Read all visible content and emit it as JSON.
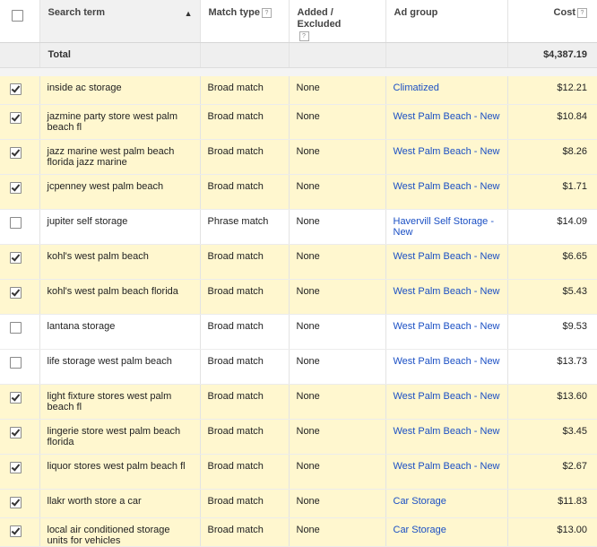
{
  "headers": {
    "search_term": "Search term",
    "match_type": "Match type",
    "added_excluded": "Added / Excluded",
    "ad_group": "Ad group",
    "cost": "Cost",
    "help": "?",
    "sort_arrow": "▲"
  },
  "total": {
    "label": "Total",
    "cost": "$4,387.19"
  },
  "rows": [
    {
      "checked": true,
      "term": "inside ac storage",
      "match": "Broad match",
      "added": "None",
      "ad_group": "Climatized",
      "cost": "$12.21"
    },
    {
      "checked": true,
      "term": "jazmine party store west palm beach fl",
      "match": "Broad match",
      "added": "None",
      "ad_group": "West Palm Beach - New",
      "cost": "$10.84"
    },
    {
      "checked": true,
      "term": "jazz marine west palm beach florida jazz marine",
      "match": "Broad match",
      "added": "None",
      "ad_group": "West Palm Beach - New",
      "cost": "$8.26"
    },
    {
      "checked": true,
      "term": "jcpenney west palm beach",
      "match": "Broad match",
      "added": "None",
      "ad_group": "West Palm Beach - New",
      "cost": "$1.71"
    },
    {
      "checked": false,
      "term": "jupiter self storage",
      "match": "Phrase match",
      "added": "None",
      "ad_group": "Havervill Self Storage - New",
      "cost": "$14.09"
    },
    {
      "checked": true,
      "term": "kohl's west palm beach",
      "match": "Broad match",
      "added": "None",
      "ad_group": "West Palm Beach - New",
      "cost": "$6.65"
    },
    {
      "checked": true,
      "term": "kohl's west palm beach florida",
      "match": "Broad match",
      "added": "None",
      "ad_group": "West Palm Beach - New",
      "cost": "$5.43"
    },
    {
      "checked": false,
      "term": "lantana storage",
      "match": "Broad match",
      "added": "None",
      "ad_group": "West Palm Beach - New",
      "cost": "$9.53"
    },
    {
      "checked": false,
      "term": "life storage west palm beach",
      "match": "Broad match",
      "added": "None",
      "ad_group": "West Palm Beach - New",
      "cost": "$13.73"
    },
    {
      "checked": true,
      "term": "light fixture stores west palm beach fl",
      "match": "Broad match",
      "added": "None",
      "ad_group": "West Palm Beach - New",
      "cost": "$13.60"
    },
    {
      "checked": true,
      "term": "lingerie store west palm beach florida",
      "match": "Broad match",
      "added": "None",
      "ad_group": "West Palm Beach - New",
      "cost": "$3.45"
    },
    {
      "checked": true,
      "term": "liquor stores west palm beach fl",
      "match": "Broad match",
      "added": "None",
      "ad_group": "West Palm Beach - New",
      "cost": "$2.67"
    },
    {
      "checked": true,
      "term": "llakr worth store a car",
      "match": "Broad match",
      "added": "None",
      "ad_group": "Car Storage",
      "cost": "$11.83"
    },
    {
      "checked": true,
      "term": "local air conditioned storage units for vehicles",
      "match": "Broad match",
      "added": "None",
      "ad_group": "Car Storage",
      "cost": "$13.00"
    }
  ]
}
